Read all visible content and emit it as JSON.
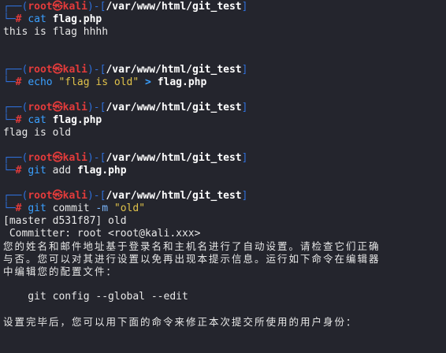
{
  "prompt": {
    "corner_top": "┌──(",
    "user": "root",
    "skull": "㉿",
    "host": "kali",
    "bracket_mid": ")-[",
    "path": "/var/www/html/git_test",
    "bracket_end": "]",
    "corner_bottom": "└─",
    "hash": "#"
  },
  "blocks": [
    {
      "cmd": "cat",
      "args": [
        "flag.php"
      ],
      "output": [
        "this is flag hhhh"
      ]
    },
    {
      "cmd": "echo",
      "string": "\"flag is old\"",
      "op": ">",
      "target": "flag.php",
      "output": []
    },
    {
      "cmd": "cat",
      "args": [
        "flag.php"
      ],
      "output": [
        "flag is old"
      ]
    },
    {
      "cmd": "git",
      "plain": "add",
      "args": [
        "flag.php"
      ],
      "output": []
    },
    {
      "cmd": "git",
      "plain": "commit",
      "flag": "-m",
      "string": "\"old\"",
      "output_lines": [
        "[master d531f87] old",
        " Committer: root <root@kali.xxx>",
        "您的姓名和邮件地址基于登录名和主机名进行了自动设置。请检查它们正确",
        "与否。您可以对其进行设置以免再出现本提示信息。运行如下命令在编辑器",
        "中编辑您的配置文件：",
        "",
        "    git config --global --edit",
        "",
        "设置完毕后，您可以用下面的命令来修正本次提交所使用的用户身份："
      ]
    }
  ]
}
